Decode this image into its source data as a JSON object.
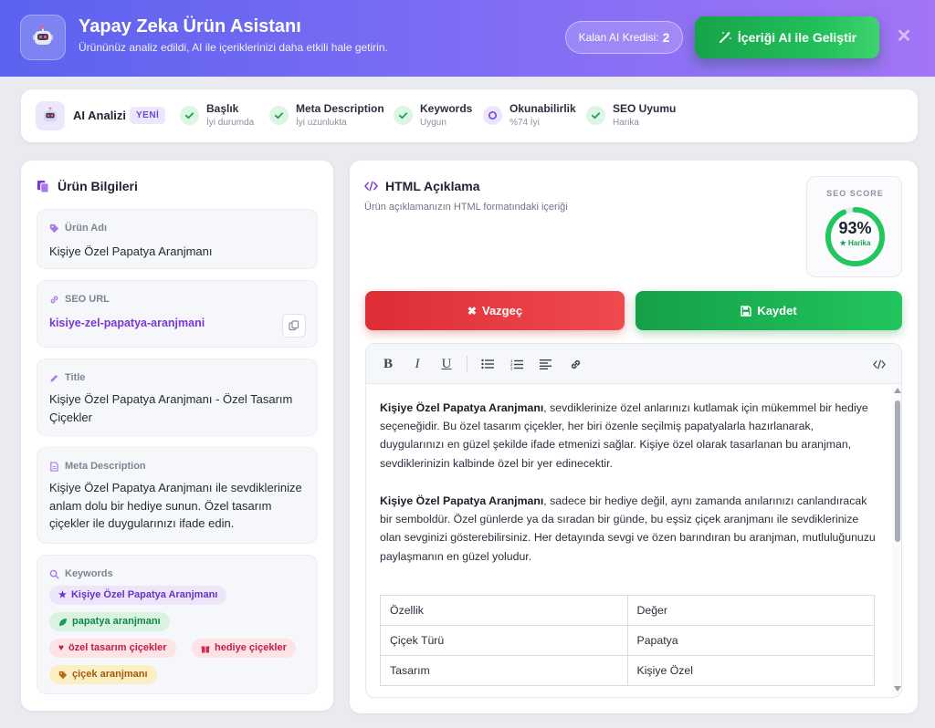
{
  "header": {
    "title": "Yapay Zeka Ürün Asistanı",
    "subtitle": "Ürününüz analiz edildi, AI ile içeriklerinizi daha etkili hale getirin.",
    "credit_label": "Kalan AI Kredisi:",
    "credit_value": "2",
    "improve_button": "İçeriği AI ile Geliştir",
    "close_icon": "close-icon"
  },
  "analysis": {
    "label": "AI Analizi",
    "badge": "YENİ",
    "metrics": [
      {
        "title": "Başlık",
        "status": "İyi durumda",
        "icon": "check-icon"
      },
      {
        "title": "Meta Description",
        "status": "İyi uzunlukta",
        "icon": "check-icon"
      },
      {
        "title": "Keywords",
        "status": "Uygun",
        "icon": "check-icon"
      },
      {
        "title": "Okunabilirlik",
        "status": "%74 İyi",
        "icon": "circle-icon"
      },
      {
        "title": "SEO Uyumu",
        "status": "Harika",
        "icon": "check-icon"
      }
    ]
  },
  "product": {
    "panel_title": "Ürün Bilgileri",
    "name_label": "Ürün Adı",
    "name_value": "Kişiye Özel Papatya Aranjmanı",
    "url_label": "SEO URL",
    "url_value": "kisiye-zel-papatya-aranjmani",
    "title_label": "Title",
    "title_value": "Kişiye Özel Papatya Aranjmanı - Özel Tasarım Çiçekler",
    "meta_label": "Meta Description",
    "meta_value": "Kişiye Özel Papatya Aranjmanı ile sevdiklerinize anlam dolu bir hediye sunun. Özel tasarım çiçekler ile duygularınızı ifade edin.",
    "keywords_label": "Keywords",
    "keywords": [
      {
        "text": "Kişiye Özel Papatya Aranjmanı",
        "color": "purple",
        "icon": "star-icon"
      },
      {
        "text": "papatya aranjmanı",
        "color": "green",
        "icon": "leaf-icon"
      },
      {
        "text": "özel tasarım çiçekler",
        "color": "pink",
        "icon": "heart-icon"
      },
      {
        "text": "hediye çiçekler",
        "color": "pink",
        "icon": "gift-icon"
      },
      {
        "text": "çiçek aranjmanı",
        "color": "yellow",
        "icon": "tag-icon"
      }
    ]
  },
  "html_desc": {
    "title": "HTML Açıklama",
    "subtitle": "Ürün açıklamanızın HTML formatındaki içeriği",
    "seo_label": "SEO SCORE",
    "seo_score": "93%",
    "seo_score_value": 93,
    "seo_rating": "★ Harika",
    "cancel_button": "Vazgeç",
    "save_button": "Kaydet",
    "p1_bold": "Kişiye Özel Papatya Aranjmanı",
    "p1_text": ", sevdiklerinize özel anlarınızı kutlamak için mükemmel bir hediye seçeneğidir. Bu özel tasarım çiçekler, her biri özenle seçilmiş papatyalarla hazırlanarak, duygularınızı en güzel şekilde ifade etmenizi sağlar. Kişiye özel olarak tasarlanan bu aranjman, sevdiklerinizin kalbinde özel bir yer edinecektir.",
    "p2_bold": "Kişiye Özel Papatya Aranjmanı",
    "p2_text": ", sadece bir hediye değil, aynı zamanda anılarınızı canlandıracak bir semboldür. Özel günlerde ya da sıradan bir günde, bu eşsiz çiçek aranjmanı ile sevdiklerinize olan sevginizi gösterebilirsiniz. Her detayında sevgi ve özen barındıran bu aranjman, mutluluğunuzu paylaşmanın en güzel yoludur.",
    "table": [
      [
        "Özellik",
        "Değer"
      ],
      [
        "Çiçek Türü",
        "Papatya"
      ],
      [
        "Tasarım",
        "Kişiye Özel"
      ]
    ]
  },
  "colors": {
    "header_start": "#5b62ef",
    "header_end": "#a274f6",
    "success": "#22c55e",
    "danger": "#e43a40",
    "accent": "#7a36d8"
  }
}
